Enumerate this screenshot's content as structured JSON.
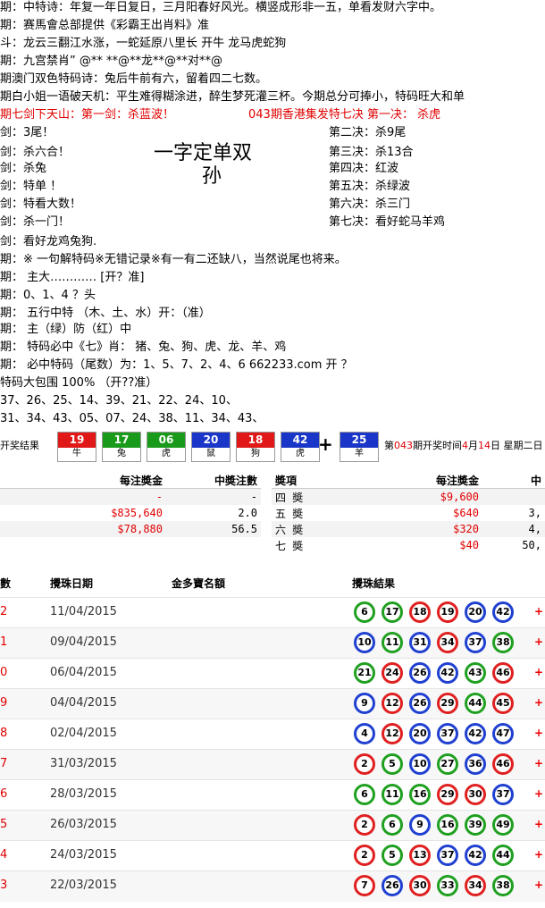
{
  "lines": [
    {
      "text": "期：中特诗：年复一年日复日，三月阳春好风光。横竖成形非一五，单看发财六字中。"
    },
    {
      "text": " 期：赛馬會总部提供《彩霸王出肖料》准"
    },
    {
      "text": "斗：龙云三翻江水涨，一蛇延原八里长 开牛 龙马虎蛇狗"
    },
    {
      "text": " 期：九宫禁肖” @** **@**龙**@**对**@"
    },
    {
      "text": " 期澳门双色特码诗：兔后牛前有六，留着四二七数。"
    },
    {
      "text": " 期白小姐一语破天机：平生难得糊涂进，醉生梦死灌三杯。今期总分可捧小，特码旺大和单"
    },
    {
      "text": "期七剑下天山：第一剑：杀蓝波！",
      "red": true
    },
    {
      "text": "剑：3尾！"
    },
    {
      "text": "剑：杀六合！"
    },
    {
      "text": "剑：杀兔"
    },
    {
      "text": "剑：特单 ！"
    },
    {
      "text": "剑：特看大数！"
    },
    {
      "text": "剑：杀一门！"
    },
    {
      "text": "剑：看好龙鸡兔狗."
    },
    {
      "text": " 期：※ 一句解特码※无错记录※有一有二还缺八，当然说尾也将来。"
    },
    {
      "text": " 期： 主大………… [开？准]"
    },
    {
      "text": "期：0、1、4 ？头"
    },
    {
      "text": " 期： 五行中特  （木、土、水）开：（准）"
    },
    {
      "text": " 期： 主（绿）防（红）中"
    },
    {
      "text": " 期： 特码必中《七》肖： 猪、兔、狗、虎、龙、羊、鸡"
    },
    {
      "text": " 期： 必中特码（尾数）为：1、5、7、2、4、6  662233.com  开 ？"
    },
    {
      "text": "特码大包围 100%    （开??准）"
    },
    {
      "text": "     37、26、25、14、39、21、22、24、10、"
    },
    {
      "text": "     31、34、43、05、07、24、38、11、34、43、"
    }
  ],
  "right_header": "043期香港集发特七决 第一决：  杀虎",
  "right_jue": [
    "第二决：杀9尾",
    "第三决：杀13合",
    "第四决：红波",
    "第五决：杀绿波",
    "第六决：杀三门",
    "第七决：看好蛇马羊鸡"
  ],
  "big_text": {
    "line1": "一字定单双",
    "line2": "孙"
  },
  "result": {
    "label": "开奖结果",
    "balls": [
      {
        "num": "19",
        "animal": "牛",
        "color": "red"
      },
      {
        "num": "17",
        "animal": "兔",
        "color": "green"
      },
      {
        "num": "06",
        "animal": "虎",
        "color": "green"
      },
      {
        "num": "20",
        "animal": "鼠",
        "color": "blue"
      },
      {
        "num": "18",
        "animal": "狗",
        "color": "red"
      },
      {
        "num": "42",
        "animal": "虎",
        "color": "blue"
      }
    ],
    "plus": "+",
    "special": {
      "num": "25",
      "animal": "羊",
      "color": "blue"
    },
    "info_prefix": "第",
    "info_period": "043",
    "info_mid": "期开奖时间",
    "info_month": "4",
    "info_m": "月",
    "info_day": "14",
    "info_d": "日 星期二日"
  },
  "prize_left": {
    "headers": [
      "每注奬金",
      "中奬注數"
    ],
    "rows": [
      [
        "-",
        "-"
      ],
      [
        "$835,640",
        "2.0"
      ],
      [
        "$78,880",
        "56.5"
      ]
    ]
  },
  "prize_right": {
    "headers": [
      "奬項",
      "每注奬金",
      "中"
    ],
    "rows": [
      [
        "四 奬",
        "$9,600",
        ""
      ],
      [
        "五 奬",
        "$640",
        "3,"
      ],
      [
        "六 奬",
        "$320",
        "4,"
      ],
      [
        "七 奬",
        "$40",
        "50,"
      ]
    ]
  },
  "history": {
    "headers": [
      "數",
      "攪珠日期",
      "金多寶名額",
      "攪珠結果"
    ],
    "rows": [
      {
        "idx": "2",
        "date": "11/04/2015",
        "balls": [
          [
            "6",
            "green"
          ],
          [
            "17",
            "green"
          ],
          [
            "18",
            "red"
          ],
          [
            "19",
            "red"
          ],
          [
            "20",
            "blue"
          ],
          [
            "42",
            "blue"
          ]
        ]
      },
      {
        "idx": "1",
        "date": "09/04/2015",
        "balls": [
          [
            "10",
            "blue"
          ],
          [
            "11",
            "green"
          ],
          [
            "31",
            "blue"
          ],
          [
            "34",
            "red"
          ],
          [
            "37",
            "blue"
          ],
          [
            "38",
            "green"
          ]
        ]
      },
      {
        "idx": "0",
        "date": "06/04/2015",
        "balls": [
          [
            "21",
            "green"
          ],
          [
            "24",
            "red"
          ],
          [
            "26",
            "blue"
          ],
          [
            "42",
            "blue"
          ],
          [
            "43",
            "green"
          ],
          [
            "46",
            "red"
          ]
        ]
      },
      {
        "idx": "9",
        "date": "04/04/2015",
        "balls": [
          [
            "9",
            "blue"
          ],
          [
            "12",
            "red"
          ],
          [
            "26",
            "blue"
          ],
          [
            "29",
            "red"
          ],
          [
            "44",
            "green"
          ],
          [
            "45",
            "red"
          ]
        ]
      },
      {
        "idx": "8",
        "date": "02/04/2015",
        "balls": [
          [
            "4",
            "blue"
          ],
          [
            "12",
            "red"
          ],
          [
            "20",
            "blue"
          ],
          [
            "37",
            "blue"
          ],
          [
            "42",
            "blue"
          ],
          [
            "47",
            "blue"
          ]
        ]
      },
      {
        "idx": "7",
        "date": "31/03/2015",
        "balls": [
          [
            "2",
            "red"
          ],
          [
            "5",
            "green"
          ],
          [
            "10",
            "blue"
          ],
          [
            "27",
            "green"
          ],
          [
            "36",
            "blue"
          ],
          [
            "46",
            "red"
          ]
        ]
      },
      {
        "idx": "6",
        "date": "28/03/2015",
        "balls": [
          [
            "6",
            "green"
          ],
          [
            "11",
            "green"
          ],
          [
            "16",
            "green"
          ],
          [
            "29",
            "red"
          ],
          [
            "30",
            "red"
          ],
          [
            "37",
            "blue"
          ]
        ]
      },
      {
        "idx": "5",
        "date": "26/03/2015",
        "balls": [
          [
            "2",
            "red"
          ],
          [
            "6",
            "green"
          ],
          [
            "9",
            "blue"
          ],
          [
            "16",
            "green"
          ],
          [
            "39",
            "green"
          ],
          [
            "49",
            "green"
          ]
        ]
      },
      {
        "idx": "4",
        "date": "24/03/2015",
        "balls": [
          [
            "2",
            "red"
          ],
          [
            "5",
            "green"
          ],
          [
            "13",
            "red"
          ],
          [
            "37",
            "blue"
          ],
          [
            "42",
            "blue"
          ],
          [
            "44",
            "green"
          ]
        ]
      },
      {
        "idx": "3",
        "date": "22/03/2015",
        "balls": [
          [
            "7",
            "red"
          ],
          [
            "26",
            "blue"
          ],
          [
            "30",
            "red"
          ],
          [
            "33",
            "green"
          ],
          [
            "34",
            "red"
          ],
          [
            "38",
            "green"
          ]
        ]
      }
    ],
    "plus": "+"
  },
  "colors": {
    "red": "#e01818",
    "green": "#1a9a1a",
    "blue": "#1a36c8"
  }
}
